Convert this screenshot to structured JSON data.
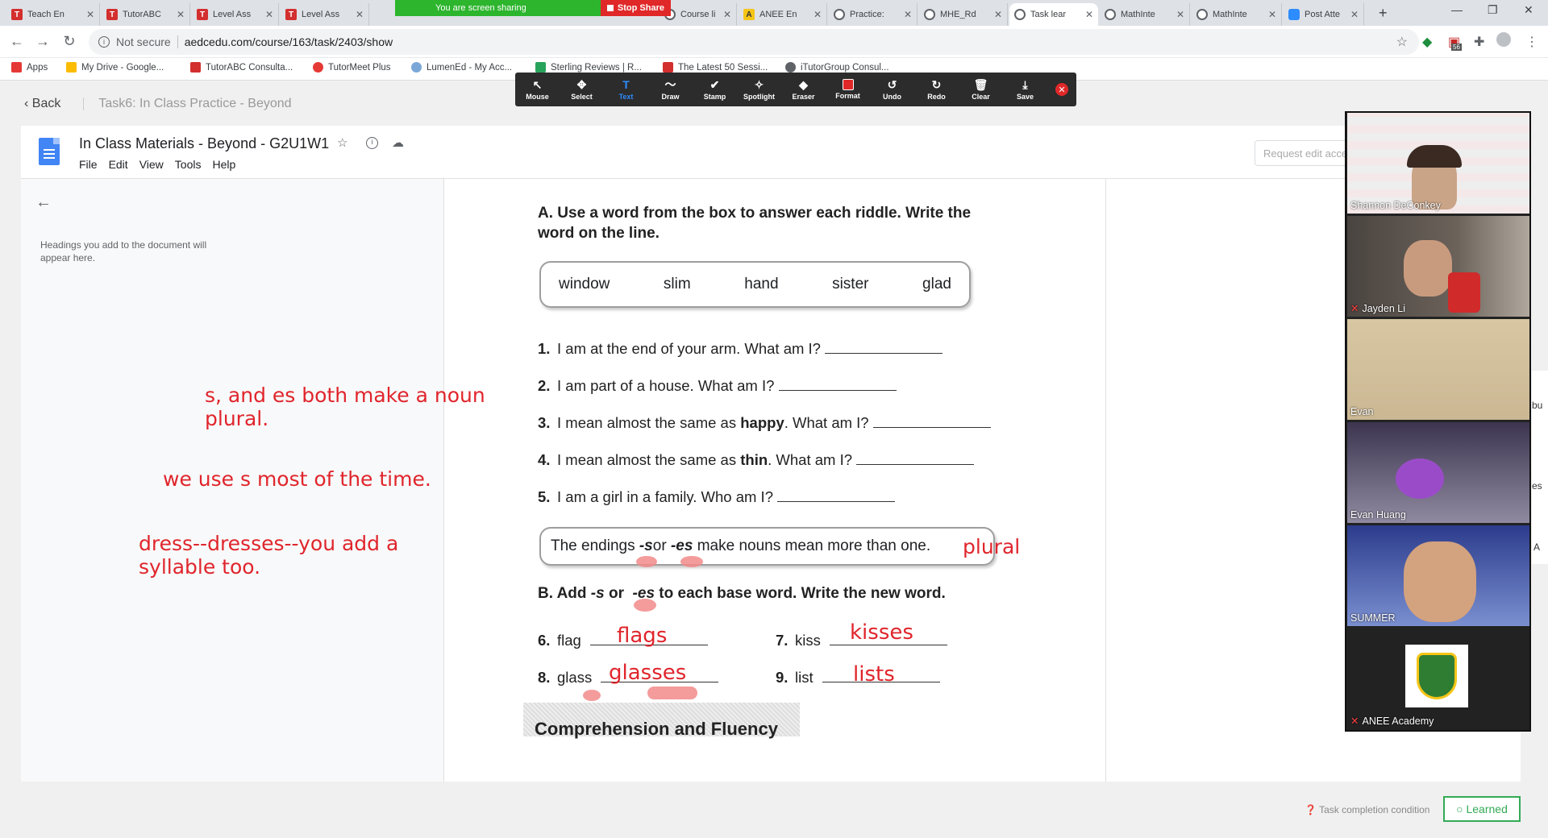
{
  "tabs": [
    {
      "label": "Teach En",
      "icon": "tutorabc-icon"
    },
    {
      "label": "TutorABC",
      "icon": "tutorabc-icon"
    },
    {
      "label": "Level Ass",
      "icon": "tutorabc-icon"
    },
    {
      "label": "Level Ass",
      "icon": "tutorabc-icon"
    },
    {
      "label": "Course li",
      "icon": "globe-icon"
    },
    {
      "label": "ANEE En",
      "icon": "anee-icon"
    },
    {
      "label": "Practice:",
      "icon": "globe-icon"
    },
    {
      "label": "MHE_Rd",
      "icon": "globe-icon"
    },
    {
      "label": "Task lear",
      "icon": "globe-icon"
    },
    {
      "label": "MathInte",
      "icon": "globe-icon"
    },
    {
      "label": "MathInte",
      "icon": "globe-icon"
    },
    {
      "label": "Post Atte",
      "icon": "zoom-icon"
    }
  ],
  "address": {
    "security": "Not secure",
    "url": "aedcedu.com/course/163/task/2403/show"
  },
  "extension_badge": "56",
  "bookmarks": [
    {
      "label": "Apps",
      "color": "#e53935"
    },
    {
      "label": "My Drive - Google...",
      "color": "#fbbc04"
    },
    {
      "label": "TutorABC Consulta...",
      "color": "#d32f2f"
    },
    {
      "label": "TutorMeet Plus",
      "color": "#e53935"
    },
    {
      "label": "LumenEd - My Acc...",
      "color": "#7aa7d8"
    },
    {
      "label": "Sterling Reviews | R...",
      "color": "#27a35c"
    },
    {
      "label": "The Latest 50 Sessi...",
      "color": "#d32f2f"
    },
    {
      "label": "iTutorGroup Consul...",
      "color": "#5f6368"
    }
  ],
  "share": {
    "message": "You are screen sharing",
    "stop": "Stop Share"
  },
  "annotate": [
    {
      "label": "Mouse",
      "icon": "↖"
    },
    {
      "label": "Select",
      "icon": "✥"
    },
    {
      "label": "Text",
      "icon": "T"
    },
    {
      "label": "Draw",
      "icon": "〜"
    },
    {
      "label": "Stamp",
      "icon": "✔"
    },
    {
      "label": "Spotlight",
      "icon": "✧"
    },
    {
      "label": "Eraser",
      "icon": "◆"
    },
    {
      "label": "Format",
      "icon": ""
    },
    {
      "label": "Undo",
      "icon": "↺"
    },
    {
      "label": "Redo",
      "icon": "↻"
    },
    {
      "label": "Clear",
      "icon": "🗑"
    },
    {
      "label": "Save",
      "icon": "⤓"
    }
  ],
  "task": {
    "back": "Back",
    "title": "Task6:  In Class Practice - Beyond"
  },
  "doc": {
    "title": "In Class Materials - Beyond - G2U1W1",
    "menu": [
      "File",
      "Edit",
      "View",
      "Tools",
      "Help"
    ],
    "request": "Request edit access",
    "outline_hint": "Headings you add to the document will appear here."
  },
  "notes": {
    "n1": "s, and es both make a noun plural.",
    "n2": "we use s most of the time.",
    "n3": "dress--dresses--you add a syllable too."
  },
  "worksheet": {
    "headA": "A. Use a word from the box to answer each riddle. Write the word on the line.",
    "words": [
      "window",
      "slim",
      "hand",
      "sister",
      "glad"
    ],
    "questions": [
      {
        "num": "1.",
        "pre": "I am at the end of your arm. What am I?",
        "bold": "",
        "post": ""
      },
      {
        "num": "2.",
        "pre": "I am part of a house. What am I?",
        "bold": "",
        "post": ""
      },
      {
        "num": "3.",
        "pre": "I mean almost the same as ",
        "bold": "happy",
        "post": ". What am I?"
      },
      {
        "num": "4.",
        "pre": "I mean almost the same as ",
        "bold": "thin",
        "post": ". What am I?"
      },
      {
        "num": "5.",
        "pre": "I am a girl in a family. Who am I?",
        "bold": "",
        "post": ""
      }
    ],
    "rule": {
      "pre": "The endings ",
      "s": "-s",
      "or": " or ",
      "es": "-es",
      "post": " make nouns mean more than one."
    },
    "rule_note": "plural",
    "headB": {
      "pre": "B. Add ",
      "s": "-s",
      "or": " or ",
      "es": "-es",
      "post": " to each base word. Write the new word."
    },
    "items": [
      {
        "num": "6.",
        "word": "flag",
        "answer": "flags"
      },
      {
        "num": "7.",
        "word": "kiss",
        "answer": "kisses"
      },
      {
        "num": "8.",
        "word": "glass",
        "answer": "glasses"
      },
      {
        "num": "9.",
        "word": "list",
        "answer": "lists"
      }
    ],
    "comp": "Comprehension and Fluency"
  },
  "participants": [
    {
      "name": "Shannon DeConkey",
      "muted": false
    },
    {
      "name": "Jayden Li",
      "muted": true
    },
    {
      "name": "Evan",
      "muted": false
    },
    {
      "name": "Evan Huang",
      "muted": false
    },
    {
      "name": "SUMMER",
      "muted": false
    },
    {
      "name": "ANEE Academy",
      "muted": true
    }
  ],
  "footer": {
    "condition": "Task completion condition",
    "learned": "Learned"
  },
  "edge": {
    "e1": "bu",
    "e2": "es",
    "e3": "A"
  }
}
